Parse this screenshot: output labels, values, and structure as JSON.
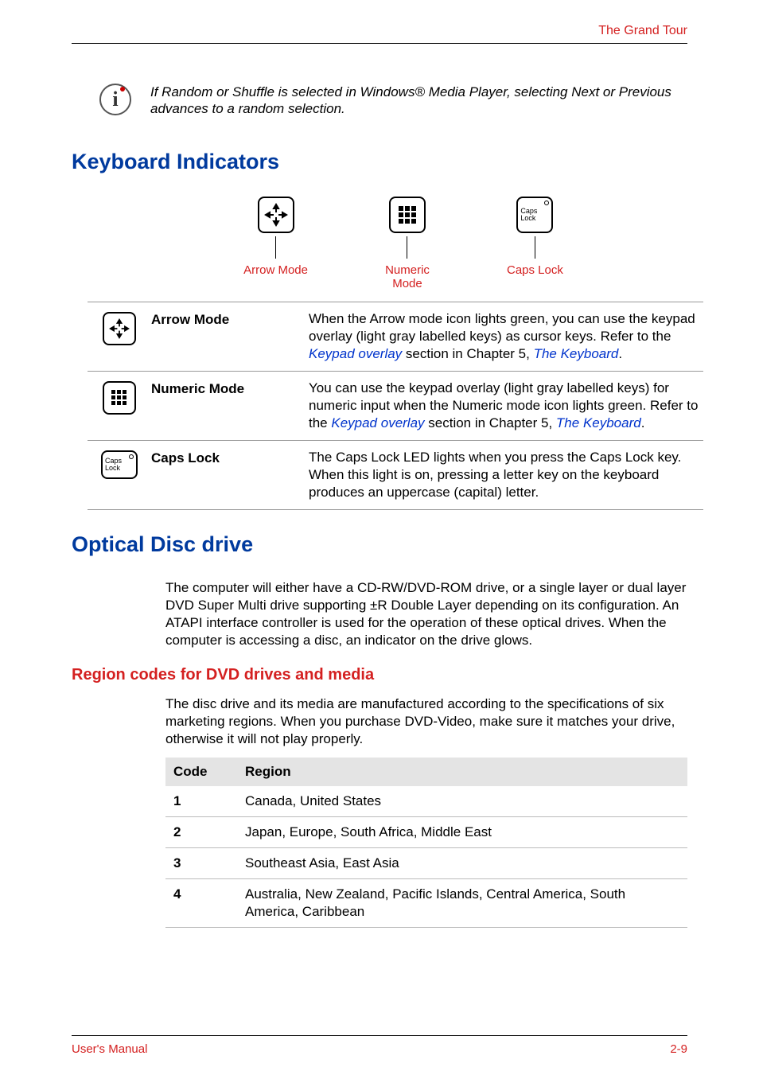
{
  "header": {
    "title": "The Grand Tour"
  },
  "note": {
    "text": "If Random or Shuffle is selected in Windows® Media Player, selecting Next or Previous advances to a random selection."
  },
  "keyboardIndicators": {
    "heading": "Keyboard Indicators",
    "diagram": {
      "arrow": "Arrow Mode",
      "numeric": "Numeric Mode",
      "caps": "Caps Lock",
      "capsKey": "Caps Lock"
    },
    "rows": [
      {
        "label": "Arrow Mode",
        "desc_pre": "When the Arrow mode icon lights green, you can use the keypad overlay (light gray labelled keys) as cursor keys. Refer to the ",
        "link1": "Keypad overlay",
        "mid": " section in Chapter 5, ",
        "link2": "The Keyboard",
        "post": "."
      },
      {
        "label": "Numeric Mode",
        "desc_pre": "You can use the keypad overlay (light gray labelled keys) for numeric input when the Numeric mode icon lights green. Refer to the ",
        "link1": "Keypad overlay",
        "mid": " section in Chapter 5, ",
        "link2": "The Keyboard",
        "post": "."
      },
      {
        "label": "Caps Lock",
        "desc_pre": "The Caps Lock LED lights when you press the Caps Lock key. When this light is on, pressing a letter key on the keyboard produces an uppercase (capital) letter.",
        "link1": "",
        "mid": "",
        "link2": "",
        "post": ""
      }
    ]
  },
  "opticalDisc": {
    "heading": "Optical Disc drive",
    "para": "The computer will either have a CD-RW/DVD-ROM drive, or a single layer or dual layer DVD Super Multi drive supporting ±R Double Layer depending on its configuration. An ATAPI interface controller is used for the operation of these optical drives. When the computer is accessing a disc, an indicator on the drive glows."
  },
  "regionCodes": {
    "heading": "Region codes for DVD drives and media",
    "para": "The disc drive and its media are manufactured according to the specifications of six marketing regions. When you purchase DVD-Video, make sure it matches your drive, otherwise it will not play properly.",
    "headers": {
      "code": "Code",
      "region": "Region"
    },
    "rows": [
      {
        "code": "1",
        "region": "Canada, United States"
      },
      {
        "code": "2",
        "region": "Japan, Europe, South Africa, Middle East"
      },
      {
        "code": "3",
        "region": "Southeast Asia, East Asia"
      },
      {
        "code": "4",
        "region": "Australia, New Zealand, Pacific Islands, Central America, South America, Caribbean"
      }
    ]
  },
  "footer": {
    "left": "User's Manual",
    "right": "2-9"
  }
}
